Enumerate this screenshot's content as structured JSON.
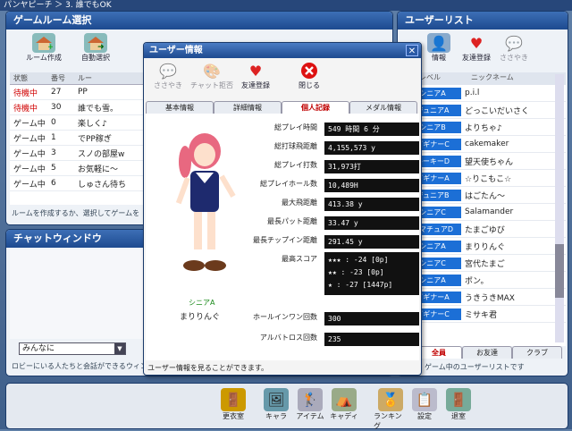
{
  "topbar": {
    "text": "パンヤピーチ ＞ 3. 誰でもOK"
  },
  "game_room": {
    "title": "ゲームルーム選択",
    "toolbar": [
      {
        "label": "ルーム作成",
        "icon": "house-plus-icon"
      },
      {
        "label": "自動選択",
        "icon": "house-arrow-icon"
      }
    ],
    "headers": [
      "状態",
      "番号",
      "ルー"
    ],
    "rooms": [
      {
        "status": "待機中",
        "num": "27",
        "name": "PP",
        "red": true
      },
      {
        "status": "待機中",
        "num": "30",
        "name": "誰でも雪。",
        "red": true
      },
      {
        "status": "ゲーム中",
        "num": "0",
        "name": "楽しく♪",
        "red": false
      },
      {
        "status": "ゲーム中",
        "num": "1",
        "name": "でPP稼ぎ",
        "red": false
      },
      {
        "status": "ゲーム中",
        "num": "3",
        "name": "スノの部屋w",
        "red": false
      },
      {
        "status": "ゲーム中",
        "num": "5",
        "name": "お気軽に～",
        "red": false
      },
      {
        "status": "ゲーム中",
        "num": "6",
        "name": "しゅさん待ち",
        "red": false
      }
    ],
    "footer": "ルームを作成するか、選択してゲームを"
  },
  "chat": {
    "title": "チャットウィンドウ",
    "dropdown": "みんなに",
    "footer": "ロビーにいる人たちと会話ができるウィン"
  },
  "user_list": {
    "title": "ユーザーリスト",
    "toolbar": [
      {
        "label": "情報",
        "icon": "info-icon"
      },
      {
        "label": "友達登録",
        "icon": "hearts-icon"
      },
      {
        "label": "ささやき",
        "icon": "whisper-icon"
      }
    ],
    "headers": [
      "レベル",
      "ニックネーム"
    ],
    "users": [
      {
        "level": "シニアA",
        "name": "p.i.l"
      },
      {
        "level": "ジュニアA",
        "name": "どっこいだいさく"
      },
      {
        "level": "シニアB",
        "name": "よりちゃ♪"
      },
      {
        "level": "ビギナーC",
        "name": "cakemaker"
      },
      {
        "level": "ルーキーD",
        "name": "望天使ちゃん"
      },
      {
        "level": "ビギナーA",
        "name": "☆りこもこ☆"
      },
      {
        "level": "ジュニアB",
        "name": "はごたん～"
      },
      {
        "level": "シニアC",
        "name": "Salamander"
      },
      {
        "level": "アマチュアD",
        "name": "たまごゆび"
      },
      {
        "level": "シニアA",
        "name": "まりりんぐ"
      },
      {
        "level": "シニアC",
        "name": "宮代たまご"
      },
      {
        "level": "シニアA",
        "name": "ポン。"
      },
      {
        "level": "ビギナーA",
        "name": "うきうきMAX"
      },
      {
        "level": "ビギナーC",
        "name": "ミサキ君"
      }
    ],
    "tabs": [
      "全員",
      "お友達",
      "クラブ"
    ],
    "footer": "ゲーム中のユーザーリストです"
  },
  "dialog": {
    "title": "ユーザー情報",
    "toolbar": [
      {
        "label": "ささやき",
        "icon": "whisper-icon"
      },
      {
        "label": "チャット拒否",
        "icon": "palette-icon"
      },
      {
        "label": "友達登録",
        "icon": "hearts-icon"
      },
      {
        "label": "閉じる",
        "icon": "close-icon"
      }
    ],
    "tabs": [
      "基本情報",
      "詳細情報",
      "個人記録",
      "メダル情報"
    ],
    "character_level": "シニアA",
    "character_name": "まりりんぐ",
    "stats": [
      {
        "label": "総プレイ時間",
        "value": "549 時間 6 分"
      },
      {
        "label": "総打球飛距離",
        "value": "4,155,573 y"
      },
      {
        "label": "総プレイ打数",
        "value": "31,973打"
      },
      {
        "label": "総プレイホール数",
        "value": "10,489H"
      },
      {
        "label": "最大飛距離",
        "value": "413.38 y"
      },
      {
        "label": "最長パット距離",
        "value": "33.47 y"
      },
      {
        "label": "最長チップイン距離",
        "value": "291.45 y"
      }
    ],
    "best_label": "最高スコア",
    "best": [
      "★★★ : -24 [0p]",
      "★★ : -23 [0p]",
      "★ : -27 [1447p]"
    ],
    "extra": [
      {
        "label": "ホールインワン回数",
        "value": "300"
      },
      {
        "label": "アルバトロス回数",
        "value": "235"
      }
    ],
    "footer": "ユーザー情報を見ることができます。"
  },
  "bottom_bar": {
    "buttons": [
      {
        "label": "更衣室",
        "icon": "locker-icon"
      },
      {
        "label": "キャラ",
        "icon": "character-icon"
      },
      {
        "label": "アイテム",
        "icon": "item-icon"
      },
      {
        "label": "キャディ",
        "icon": "caddie-icon"
      },
      {
        "label": "ランキング",
        "icon": "ranking-icon"
      },
      {
        "label": "設定",
        "icon": "settings-icon"
      },
      {
        "label": "退室",
        "icon": "exit-icon"
      }
    ]
  },
  "colors": {
    "title_blue": "#1d4a8f",
    "badge_blue": "#1c6fd6",
    "status_red": "#d00000"
  }
}
